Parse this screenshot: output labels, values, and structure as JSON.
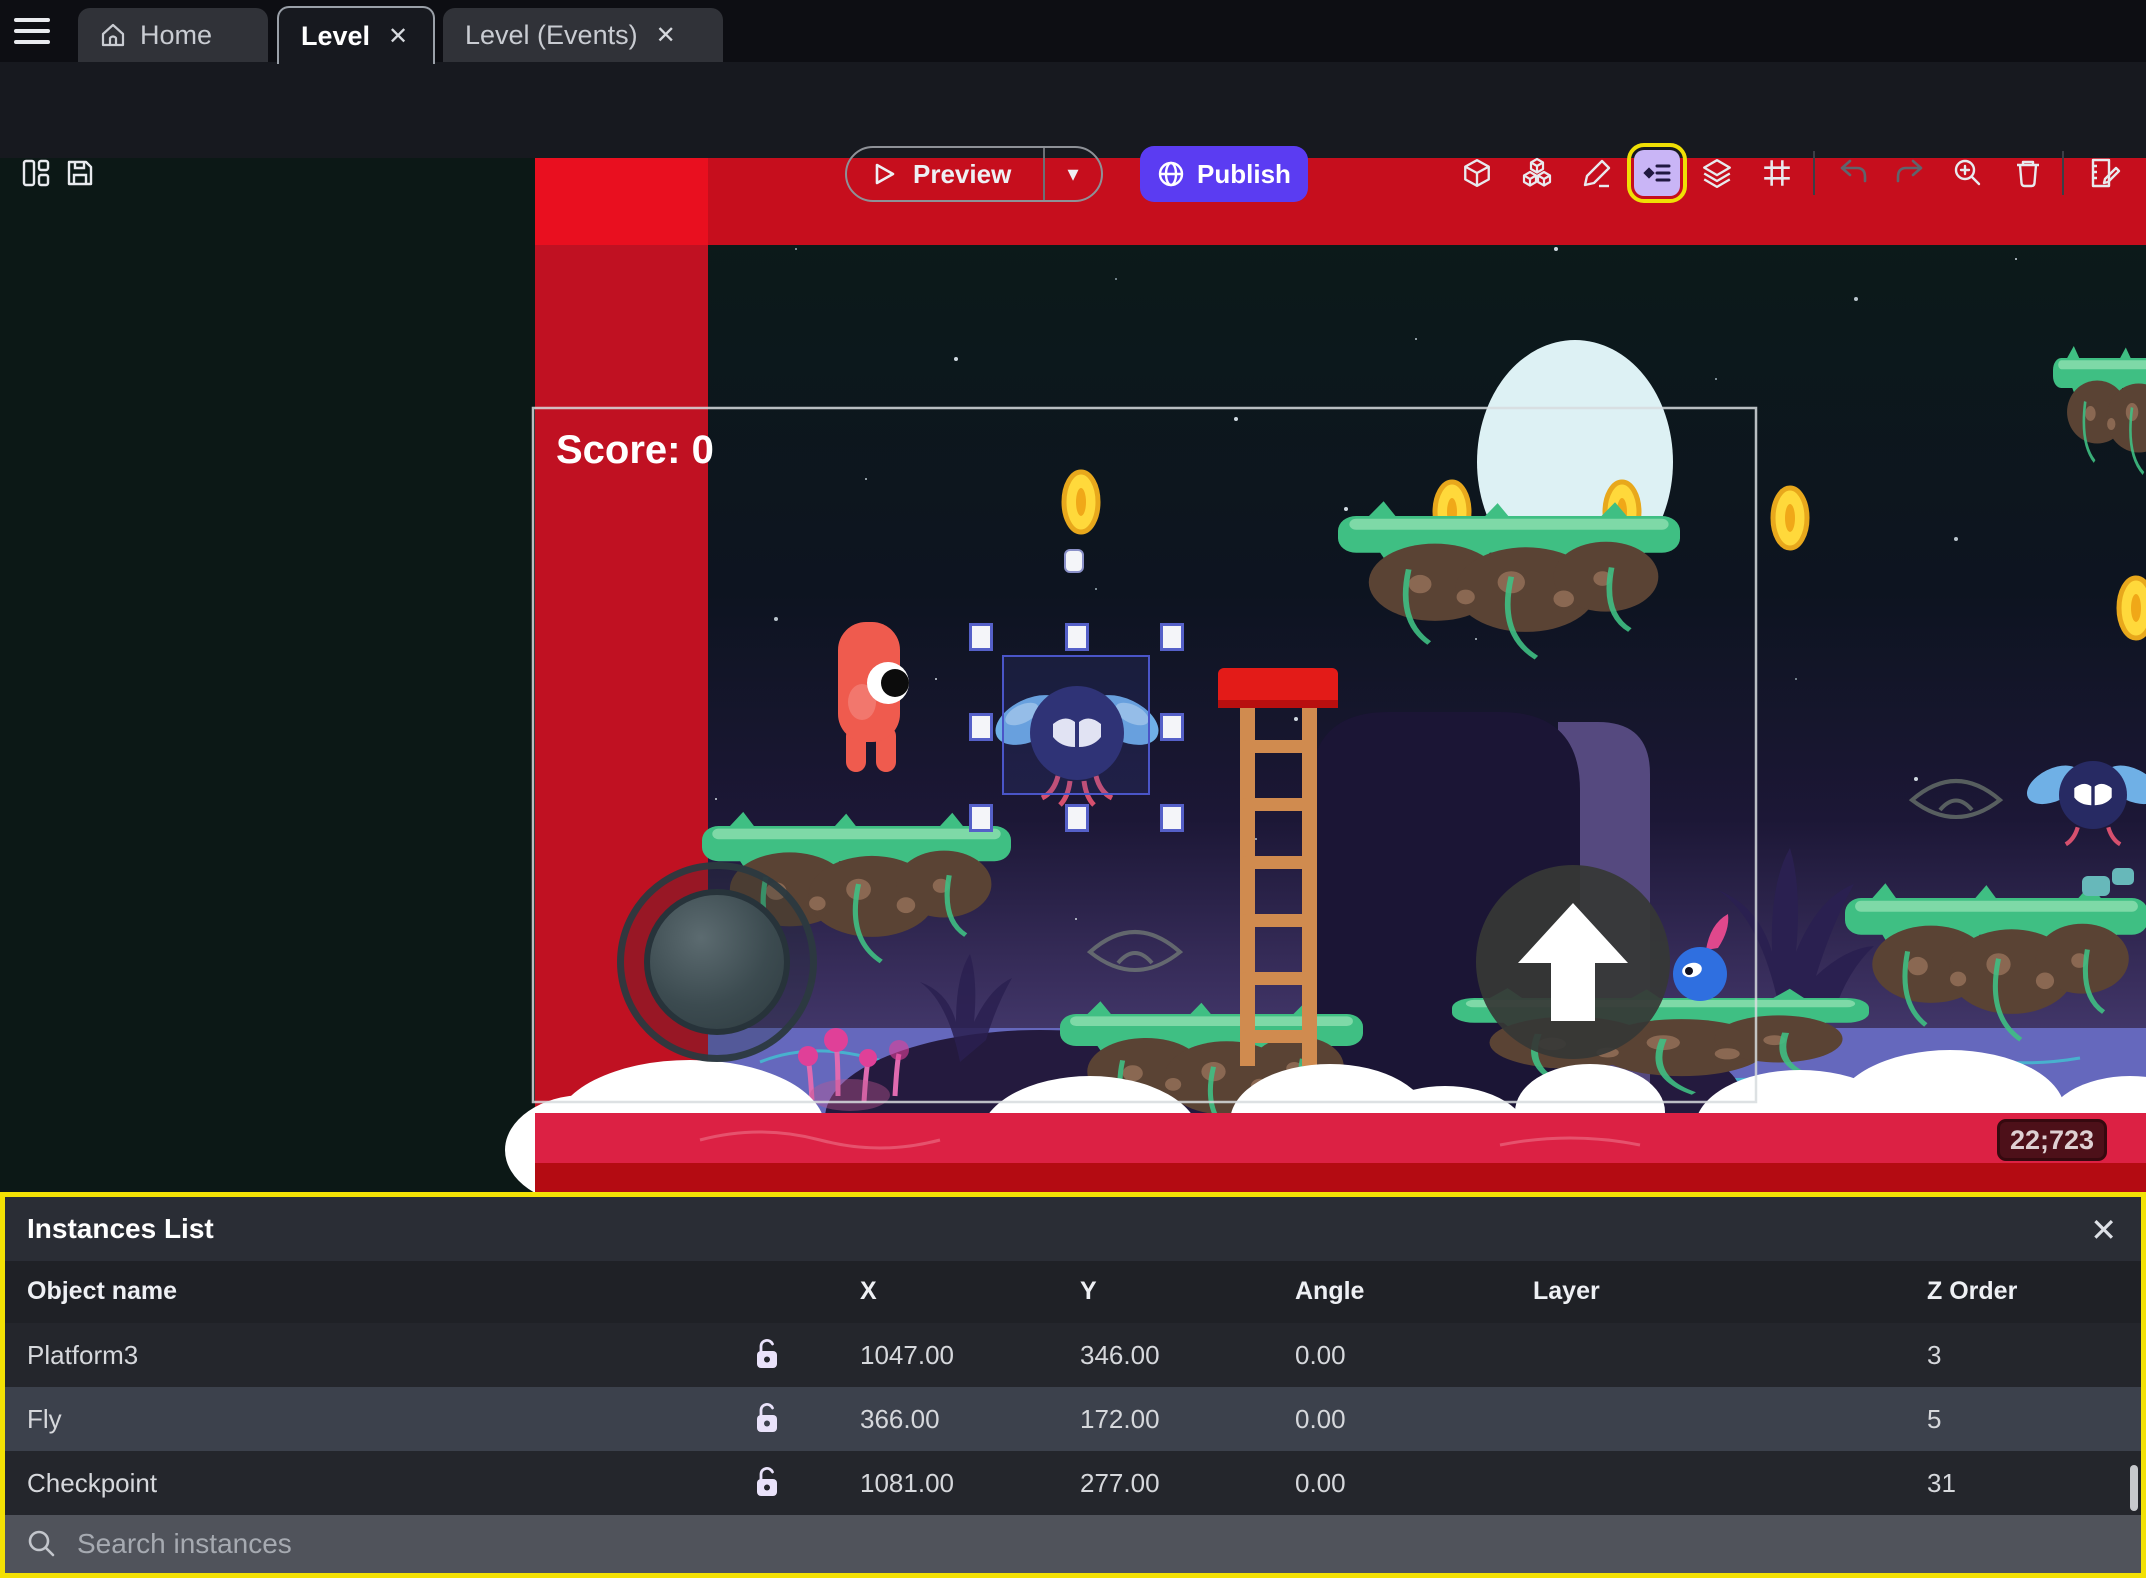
{
  "tab_bar": {
    "home": "Home",
    "level": "Level",
    "level_events": "Level (Events)",
    "close_glyph": "✕"
  },
  "toolbar": {
    "preview": "Preview",
    "publish": "Publish",
    "caret_glyph": "▾"
  },
  "scene": {
    "score_label": "Score: 0",
    "coords_badge": "22;723"
  },
  "instances_panel": {
    "title": "Instances List",
    "close_glyph": "✕",
    "columns": {
      "name": "Object name",
      "x": "X",
      "y": "Y",
      "angle": "Angle",
      "layer": "Layer",
      "z": "Z Order"
    },
    "rows": [
      {
        "name": "Platform3",
        "x": "1047.00",
        "y": "346.00",
        "angle": "0.00",
        "layer": "",
        "z": "3",
        "selected": false
      },
      {
        "name": "Fly",
        "x": "366.00",
        "y": "172.00",
        "angle": "0.00",
        "layer": "",
        "z": "5",
        "selected": true
      },
      {
        "name": "Checkpoint",
        "x": "1081.00",
        "y": "277.00",
        "angle": "0.00",
        "layer": "",
        "z": "31",
        "selected": false
      }
    ],
    "search_placeholder": "Search instances"
  },
  "colors": {
    "accent_purple": "#5b3cf2",
    "highlight_yellow": "#f3e104",
    "instances_icon_bg": "#c9b5f6",
    "selected_row": "#3c414c",
    "scene_red_band": "#c60e1d",
    "crimson_band": "#dc2144"
  }
}
